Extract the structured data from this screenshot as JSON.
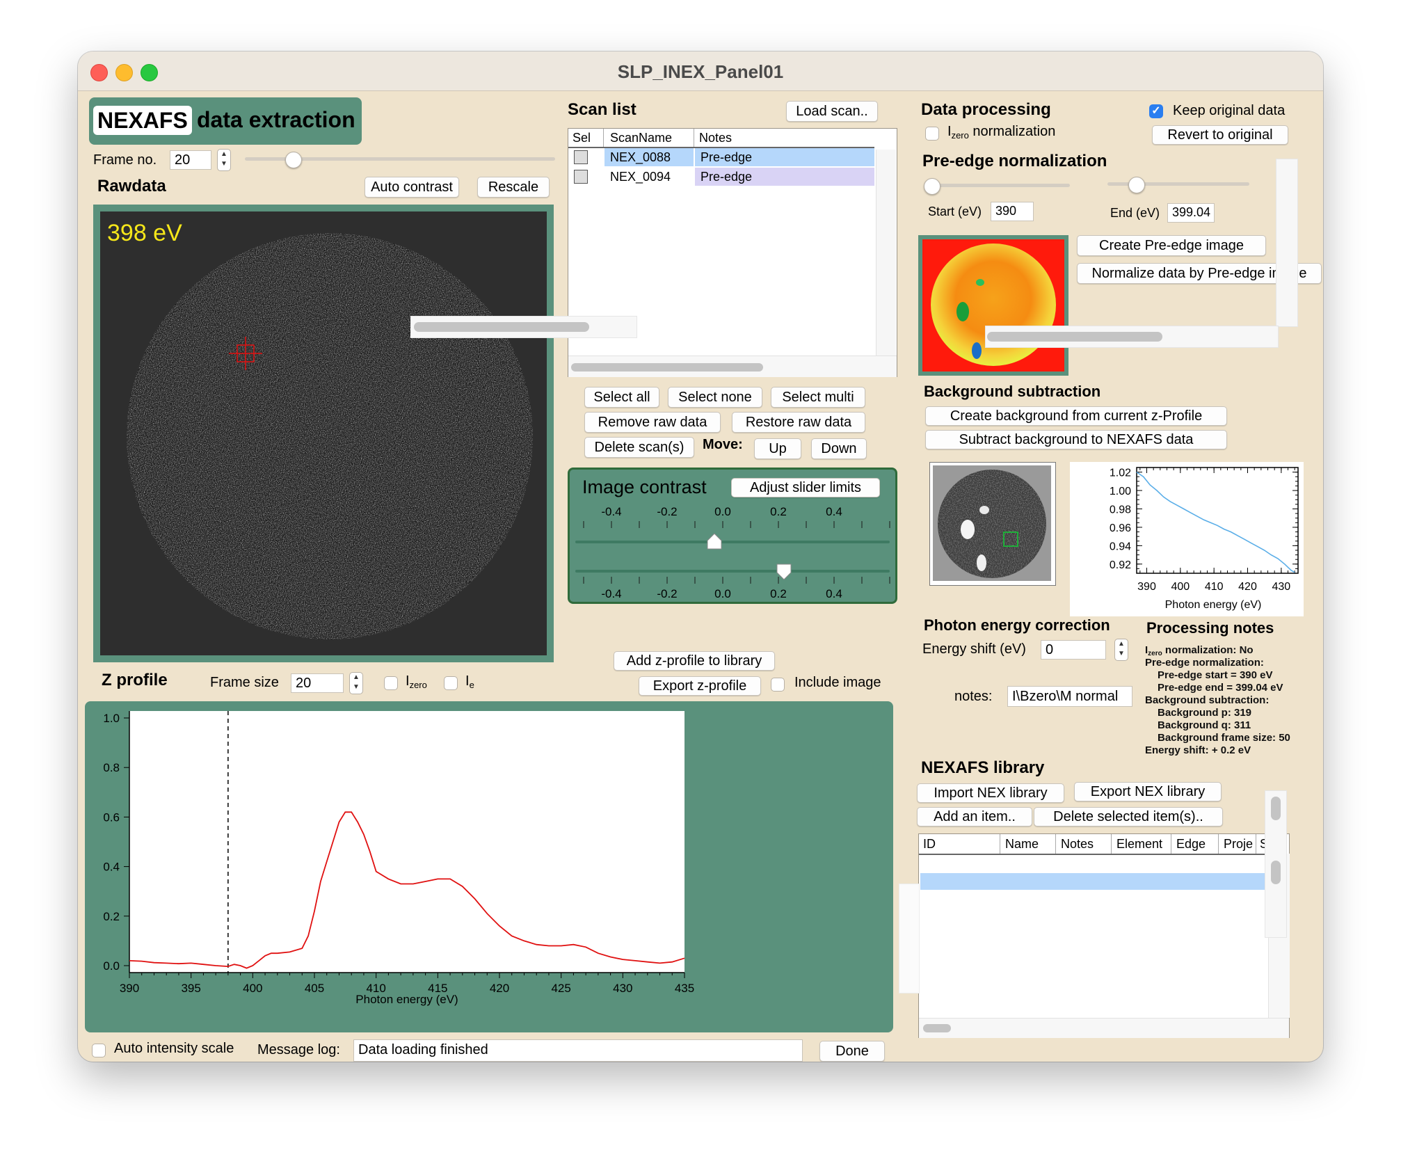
{
  "window": {
    "title": "SLP_INEX_Panel01"
  },
  "header": {
    "badge": "NEXAFS",
    "title": "data extraction"
  },
  "frame": {
    "label": "Frame no.",
    "value": "20"
  },
  "rawdata": {
    "title": "Rawdata",
    "auto_contrast": "Auto contrast",
    "rescale": "Rescale",
    "energy_label": "398 eV"
  },
  "scan_list": {
    "title": "Scan list",
    "load_button": "Load scan..",
    "columns": [
      "Sel",
      "ScanName",
      "Notes"
    ],
    "rows": [
      {
        "name": "NEX_0088",
        "notes": "Pre-edge"
      },
      {
        "name": "NEX_0094",
        "notes": "Pre-edge"
      }
    ],
    "select_all": "Select all",
    "select_none": "Select none",
    "select_multi": "Select multi",
    "remove_raw": "Remove raw data",
    "restore_raw": "Restore raw data",
    "delete_scans": "Delete scan(s)",
    "move_label": "Move:",
    "up": "Up",
    "down": "Down"
  },
  "image_contrast": {
    "title": "Image contrast",
    "adjust_button": "Adjust slider limits",
    "ticks": [
      "-0.4",
      "-0.2",
      "0.0",
      "0.2",
      "0.4"
    ],
    "low_value": -0.03,
    "high_value": 0.22
  },
  "add_zprofile": "Add z-profile to library",
  "export_zprofile": "Export z-profile",
  "include_image": "Include image",
  "zprofile": {
    "title": "Z profile",
    "frame_size_label": "Frame size",
    "frame_size_value": "20",
    "izero_label": "I",
    "izero_sub": "zero",
    "ie_label": "I",
    "ie_sub": "e"
  },
  "chart_data": {
    "type": "line",
    "xlabel": "Photon energy (eV)",
    "ylabel": "",
    "xlim": [
      390,
      435
    ],
    "ylim": [
      0.0,
      1.0
    ],
    "x_ticks": [
      "390",
      "395",
      "400",
      "405",
      "410",
      "415",
      "420",
      "425",
      "430",
      "435"
    ],
    "y_ticks": [
      "0.0",
      "0.2",
      "0.4",
      "0.6",
      "0.8",
      "1.0"
    ],
    "marker_x": 398,
    "series": [
      {
        "color": "#e01010",
        "x": [
          390,
          391,
          392,
          393,
          394,
          395,
          396,
          397,
          398,
          398.5,
          399,
          399.5,
          400,
          400.5,
          401,
          401.5,
          402,
          403,
          404,
          404.5,
          405,
          405.5,
          406,
          406.5,
          407,
          407.5,
          408,
          408.5,
          409,
          409.5,
          410,
          411,
          412,
          413,
          414,
          415,
          416,
          417,
          418,
          419,
          420,
          421,
          422,
          423,
          424,
          425,
          426,
          427,
          428,
          429,
          430,
          431,
          432,
          433,
          434,
          435
        ],
        "y": [
          0.02,
          0.018,
          0.012,
          0.01,
          0.008,
          0.01,
          0.005,
          0.0,
          -0.003,
          0.005,
          0.0,
          -0.01,
          0.0,
          0.02,
          0.04,
          0.05,
          0.05,
          0.055,
          0.07,
          0.12,
          0.22,
          0.34,
          0.42,
          0.5,
          0.58,
          0.62,
          0.62,
          0.58,
          0.53,
          0.46,
          0.38,
          0.35,
          0.33,
          0.33,
          0.34,
          0.35,
          0.35,
          0.32,
          0.27,
          0.21,
          0.16,
          0.12,
          0.1,
          0.085,
          0.08,
          0.08,
          0.085,
          0.075,
          0.05,
          0.035,
          0.025,
          0.02,
          0.015,
          0.01,
          0.015,
          0.03
        ]
      }
    ]
  },
  "bottom": {
    "auto_intensity": "Auto intensity scale",
    "message_label": "Message log:",
    "message_value": "Data loading finished",
    "done": "Done"
  },
  "data_processing": {
    "title": "Data processing",
    "keep_original": "Keep original data",
    "izero_norm_pre": "I",
    "izero_norm_sub": "zero",
    "izero_norm_post": " normalization",
    "revert": "Revert to original",
    "preedge_title": "Pre-edge normalization",
    "start_label": "Start (eV)",
    "start_value": "390",
    "end_label": "End (eV)",
    "end_value": "399.04",
    "create_preedge": "Create Pre-edge image",
    "normalize_preedge": "Normalize data by Pre-edge image"
  },
  "background": {
    "title": "Background subtraction",
    "create_button": "Create background from current z-Profile",
    "subtract_button": "Subtract background to NEXAFS data"
  },
  "bg_chart": {
    "xlabel": "Photon energy (eV)",
    "x_ticks": [
      "390",
      "400",
      "410",
      "420",
      "430"
    ],
    "y_ticks": [
      "1.02",
      "1.00",
      "0.98",
      "0.96",
      "0.94",
      "0.92"
    ],
    "xlim": [
      387,
      435
    ],
    "ylim": [
      0.91,
      1.025
    ],
    "color": "#5aaee8",
    "x": [
      387,
      389,
      391,
      393,
      395,
      397,
      399,
      401,
      403,
      405,
      407,
      409,
      411,
      413,
      415,
      417,
      419,
      421,
      423,
      425,
      427,
      429,
      431,
      433,
      434
    ],
    "y": [
      1.02,
      1.015,
      1.006,
      1.0,
      0.993,
      0.988,
      0.984,
      0.98,
      0.976,
      0.972,
      0.968,
      0.965,
      0.962,
      0.958,
      0.955,
      0.951,
      0.947,
      0.943,
      0.939,
      0.935,
      0.93,
      0.926,
      0.92,
      0.913,
      0.911
    ]
  },
  "energy_correction": {
    "title": "Photon energy correction",
    "shift_label": "Energy shift (eV)",
    "shift_value": "0",
    "notes_label": "notes:",
    "notes_value": "I\\Bzero\\M normal"
  },
  "processing_notes": {
    "title": "Processing notes",
    "izero_prefix": "I",
    "izero_sub": "zero",
    "izero_rest": " normalization: No",
    "lines": [
      "Pre-edge normalization:",
      "Pre-edge start = 390 eV",
      "Pre-edge end = 399.04 eV",
      "Background subtraction:",
      "Background p: 319",
      "Background q: 311",
      "Background frame size: 50",
      "Energy shift: + 0.2 eV"
    ]
  },
  "library": {
    "title": "NEXAFS library",
    "import": "Import NEX library",
    "export": "Export NEX library",
    "add": "Add an item..",
    "delete": "Delete selected item(s)..",
    "columns": [
      "ID",
      "Name",
      "Notes",
      "Element",
      "Edge",
      "Proje",
      "S"
    ]
  }
}
